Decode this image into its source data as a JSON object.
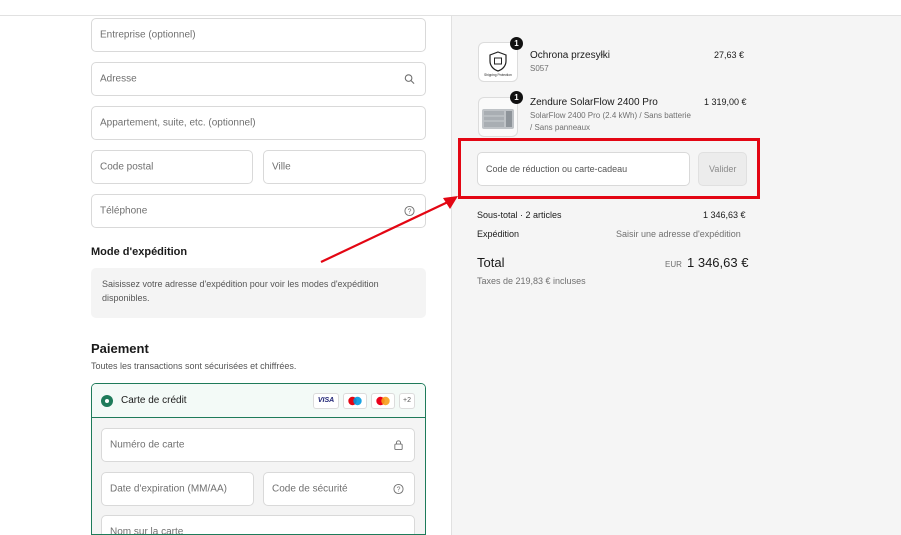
{
  "form": {
    "company_placeholder": "Entreprise (optionnel)",
    "address_placeholder": "Adresse",
    "apartment_placeholder": "Appartement, suite, etc. (optionnel)",
    "postal_code_placeholder": "Code postal",
    "city_placeholder": "Ville",
    "phone_placeholder": "Téléphone"
  },
  "shipping": {
    "title": "Mode d'expédition",
    "notice": "Saisissez votre adresse d'expédition pour voir les modes d'expédition disponibles."
  },
  "payment": {
    "title": "Paiement",
    "subtitle": "Toutes les transactions sont sécurisées et chiffrées.",
    "method_label": "Carte de crédit",
    "card_logos": [
      "VISA",
      "maestro",
      "mastercard"
    ],
    "more_logos": "+2",
    "card_number_placeholder": "Numéro de carte",
    "expiry_placeholder": "Date d'expiration (MM/AA)",
    "security_code_placeholder": "Code de sécurité",
    "name_on_card_placeholder": "Nom sur la carte"
  },
  "summary": {
    "items": [
      {
        "name": "Ochrona przesyłki",
        "variant": "S057",
        "price": "27,63 €",
        "quantity": "1",
        "thumb_text": "Shipping Protection"
      },
      {
        "name": "Zendure SolarFlow 2400 Pro",
        "variant_line1": "SolarFlow 2400 Pro (2.4 kWh) / Sans batterie",
        "variant_line2": "/ Sans panneaux",
        "price": "1 319,00 €",
        "quantity": "1"
      }
    ],
    "discount_placeholder": "Code de réduction ou carte-cadeau",
    "apply_label": "Valider",
    "subtotal_label": "Sous-total · 2 articles",
    "subtotal_value": "1 346,63 €",
    "shipping_label": "Expédition",
    "shipping_value": "Saisir une adresse d'expédition",
    "total_label": "Total",
    "currency": "EUR",
    "total_value": "1 346,63 €",
    "taxes": "Taxes de 219,83 € incluses"
  },
  "colors": {
    "accent": "#1e7b5a",
    "annotation_red": "#e30613"
  }
}
